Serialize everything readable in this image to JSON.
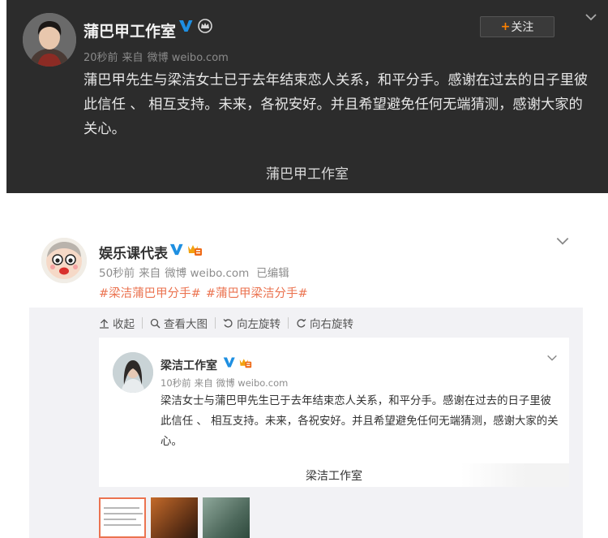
{
  "post_top": {
    "author": "蒲巴甲工作室",
    "time": "20秒前",
    "source_prefix": "来自",
    "source": "微博 weibo.com",
    "follow_label": "关注",
    "follow_plus": "+",
    "text": "蒲巴甲先生与梁洁女士已于去年结束恋人关系，和平分手。感谢在过去的日子里彼此信任 、 相互支持。未来，各祝安好。并且希望避免任何无端猜测，感谢大家的关心。",
    "signature": "蒲巴甲工作室"
  },
  "post_second": {
    "author": "娱乐课代表",
    "time": "50秒前",
    "source_prefix": "来自",
    "source": "微博 weibo.com",
    "edited": "已编辑",
    "tags": [
      "#梁洁蒲巴甲分手#",
      "#蒲巴甲梁洁分手#"
    ],
    "toolbar": {
      "collapse": "收起",
      "view_large": "查看大图",
      "rotate_left": "向左旋转",
      "rotate_right": "向右旋转"
    },
    "embedded": {
      "author": "梁洁工作室",
      "time": "10秒前",
      "source_prefix": "来自",
      "source": "微博 weibo.com",
      "text": "梁洁女士与蒲巴甲先生已于去年结束恋人关系，和平分手。感谢在过去的日子里彼此信任 、 相互支持。未来，各祝安好。并且希望避免任何无端猜测，感谢大家的关心。",
      "signature": "梁洁工作室"
    },
    "thumbnails": [
      "image-1",
      "image-2",
      "image-3"
    ]
  },
  "colors": {
    "dark_bg": "#2c2c2c",
    "verified_blue": "#1e8fe1",
    "tag_orange": "#eb7350",
    "follow_orange": "#ff8200",
    "panel_bg": "#f2f2f5"
  }
}
